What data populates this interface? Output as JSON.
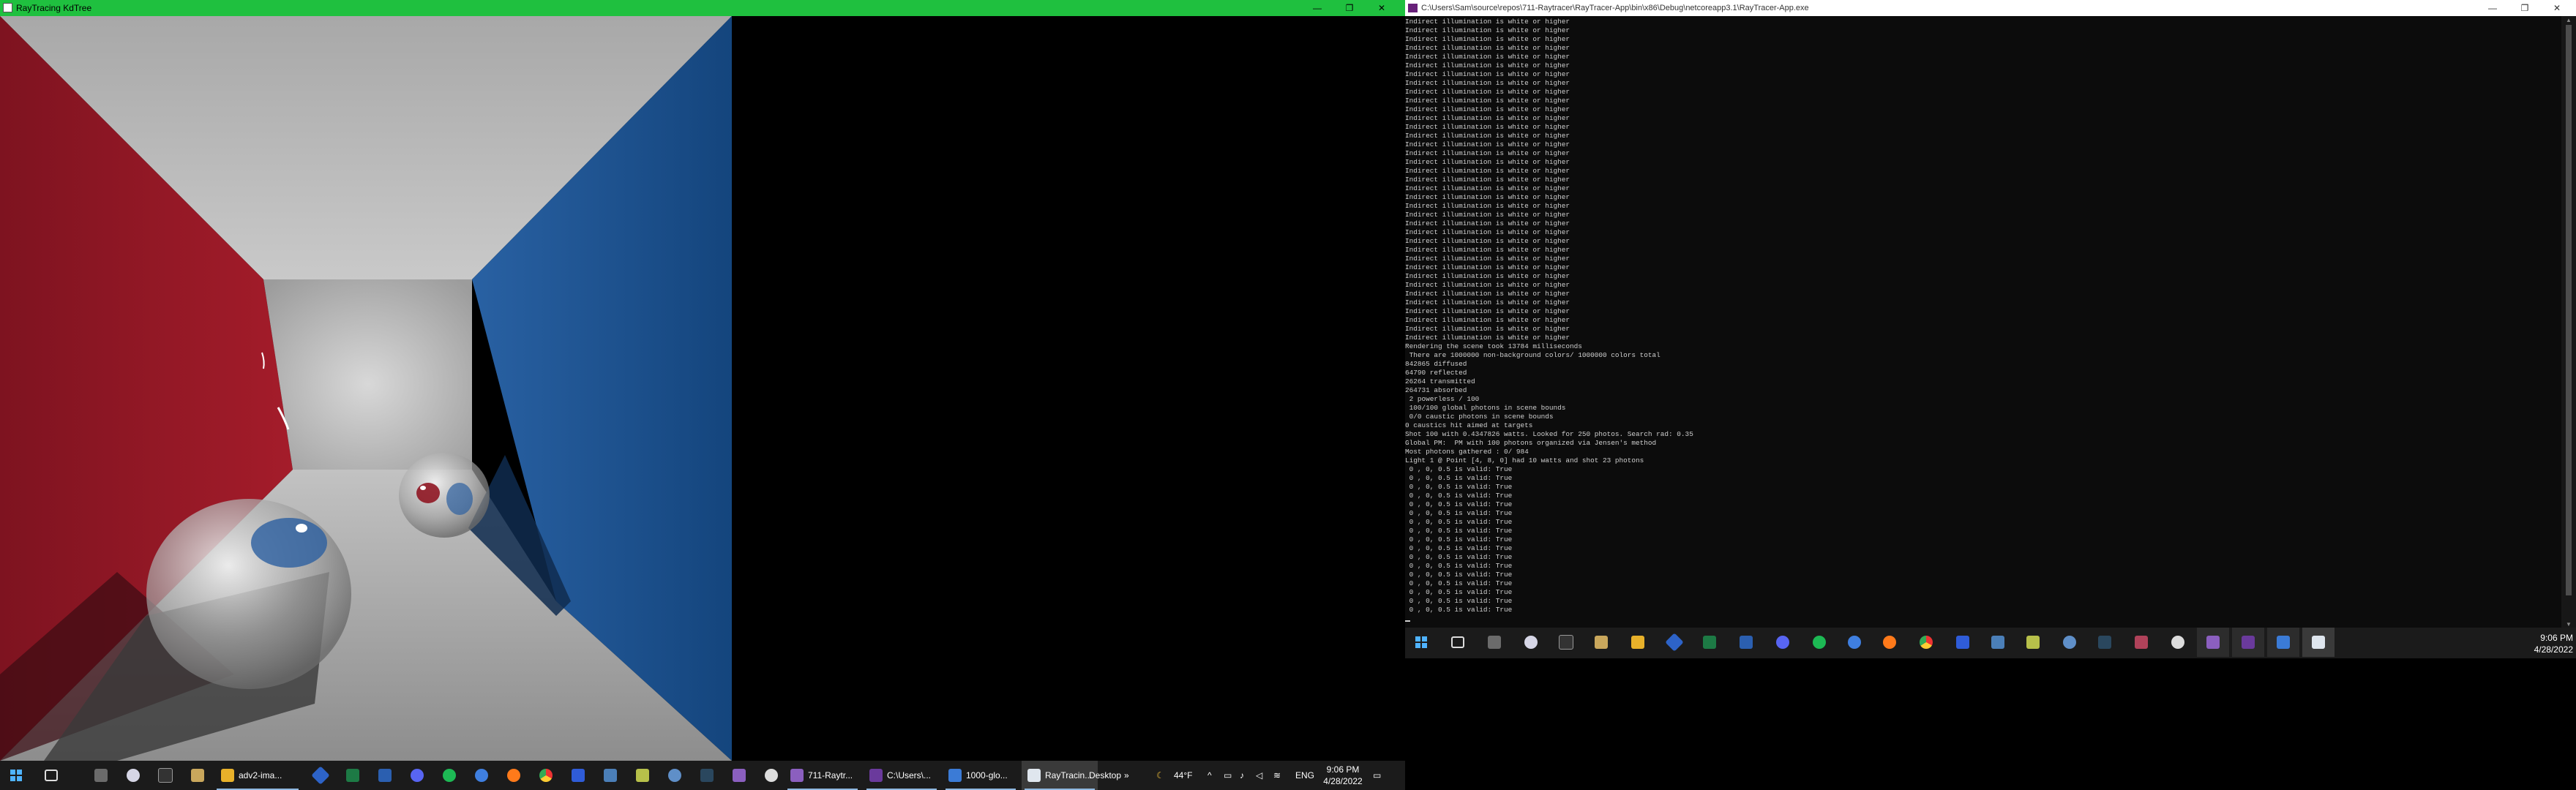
{
  "left": {
    "window_title": "RayTracing KdTree",
    "controls": {
      "minimize": "—",
      "maximize": "❐",
      "close": "✕"
    },
    "taskbar": {
      "apps": [
        {
          "label": "adv2-ima...",
          "color": "#e8b12a"
        },
        {
          "label": "711-Raytr...",
          "color": "#8b5fbf"
        },
        {
          "label": "C:\\Users\\...",
          "color": "#6a3a9c"
        },
        {
          "label": "1000-glo...",
          "color": "#3b7bd6"
        },
        {
          "label": "RayTracin...",
          "color": "#dfe6ee"
        }
      ],
      "desktop_label": "Desktop",
      "desktop_chevron": "»",
      "weather": "44°F",
      "language": "ENG",
      "time": "9:06 PM",
      "date": "4/28/2022"
    }
  },
  "right": {
    "window_title": "C:\\Users\\Sam\\source\\repos\\711-Raytracer\\RayTracer-App\\bin\\x86\\Debug\\netcoreapp3.1\\RayTracer-App.exe",
    "controls": {
      "minimize": "—",
      "maximize": "❐",
      "close": "✕"
    },
    "console": {
      "lines": [
        "Indirect illumination is white or higher",
        "Indirect illumination is white or higher",
        "Indirect illumination is white or higher",
        "Indirect illumination is white or higher",
        "Indirect illumination is white or higher",
        "Indirect illumination is white or higher",
        "Indirect illumination is white or higher",
        "Indirect illumination is white or higher",
        "Indirect illumination is white or higher",
        "Indirect illumination is white or higher",
        "Indirect illumination is white or higher",
        "Indirect illumination is white or higher",
        "Indirect illumination is white or higher",
        "Indirect illumination is white or higher",
        "Indirect illumination is white or higher",
        "Indirect illumination is white or higher",
        "Indirect illumination is white or higher",
        "Indirect illumination is white or higher",
        "Indirect illumination is white or higher",
        "Indirect illumination is white or higher",
        "Indirect illumination is white or higher",
        "Indirect illumination is white or higher",
        "Indirect illumination is white or higher",
        "Indirect illumination is white or higher",
        "Indirect illumination is white or higher",
        "Indirect illumination is white or higher",
        "Indirect illumination is white or higher",
        "Indirect illumination is white or higher",
        "Indirect illumination is white or higher",
        "Indirect illumination is white or higher",
        "Indirect illumination is white or higher",
        "Indirect illumination is white or higher",
        "Indirect illumination is white or higher",
        "Indirect illumination is white or higher",
        "Indirect illumination is white or higher",
        "Indirect illumination is white or higher",
        "Indirect illumination is white or higher",
        "Rendering the scene took 13784 milliseconds",
        " There are 1000000 non-background colors/ 1000000 colors total",
        "842865 diffused",
        "64790 reflected",
        "26264 transmitted",
        "264731 absorbed",
        " 2 powerless / 100",
        " 100/100 global photons in scene bounds",
        " 0/0 caustic photons in scene bounds",
        "0 caustics hit aimed at targets",
        "Shot 100 with 0.4347826 watts. Looked for 250 photos. Search rad: 0.35",
        "Global PM:  PM with 100 photons organized via Jensen's method",
        "Most photons gathered : 0/ 984",
        "Light 1 @ Point [4, 8, 0] had 10 watts and shot 23 photons",
        " 0 , 0, 0.5 is valid: True",
        " 0 , 0, 0.5 is valid: True",
        " 0 , 0, 0.5 is valid: True",
        " 0 , 0, 0.5 is valid: True",
        " 0 , 0, 0.5 is valid: True",
        " 0 , 0, 0.5 is valid: True",
        " 0 , 0, 0.5 is valid: True",
        " 0 , 0, 0.5 is valid: True",
        " 0 , 0, 0.5 is valid: True",
        " 0 , 0, 0.5 is valid: True",
        " 0 , 0, 0.5 is valid: True",
        " 0 , 0, 0.5 is valid: True",
        " 0 , 0, 0.5 is valid: True",
        " 0 , 0, 0.5 is valid: True",
        " 0 , 0, 0.5 is valid: True",
        " 0 , 0, 0.5 is valid: True",
        " 0 , 0, 0.5 is valid: True"
      ]
    },
    "taskbar": {
      "time": "9:06 PM",
      "date": "4/28/2022"
    }
  },
  "icons": {
    "taskbar_left": [
      "windows-start-icon",
      "task-view-icon",
      "gaming-icon",
      "paint-icon",
      "terminal-icon",
      "notepad-icon",
      "file-explorer-icon",
      "sourcetree-icon",
      "excel-icon",
      "word-icon",
      "discord-icon",
      "spotify-icon",
      "firefox-dev-icon",
      "firefox-icon",
      "chrome-icon",
      "malwarebytes-icon",
      "calculator-icon",
      "notes-icon",
      "settings-icon",
      "steam-icon",
      "snipping-icon",
      "unity-icon"
    ],
    "colors": {
      "start": "#4fb3ff",
      "excel": "#1d7a45",
      "word": "#2b5fb0",
      "discord": "#5865f2",
      "spotify": "#1db954",
      "firefox": "#ff7a1a",
      "chrome": "#e8b12a",
      "vs": "#8b5fbf"
    }
  },
  "scene": {
    "left_wall_color": "#8f1622",
    "right_wall_color": "#1f5593",
    "back_wall_color": "#b9b9b9",
    "floor_color": "#9e9e9e",
    "ceiling_color": "#c8c8c8"
  }
}
